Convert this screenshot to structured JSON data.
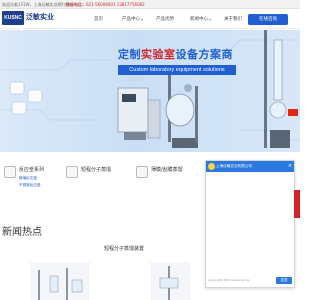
{
  "topbar": {
    "welcome": "欢迎光临131W，上海泛敏实业期刊模板中心…",
    "hotline": "热线电话：021-56008001 13817756062"
  },
  "header": {
    "logo_mark": "KUSNC",
    "logo_name": "泛敏实业",
    "nav": {
      "home": "首页",
      "products": "产品中心",
      "advantage": "产品优势",
      "news": "新闻中心",
      "about": "关于我们"
    },
    "consult_label": "在线咨询"
  },
  "banner": {
    "title_prefix": "定制",
    "title_highlight": "实验室",
    "title_suffix": "设备方案商",
    "subtitle": "Custom laboratory equipment solutions"
  },
  "categories": [
    {
      "label": "反应釜系列",
      "lines": [
        "玻璃反应釜",
        "不锈钢反应釜"
      ]
    },
    {
      "label": "短程分子蒸馏",
      "lines": []
    },
    {
      "label": "薄膜/刮膜蒸馏",
      "lines": []
    }
  ],
  "chat": {
    "title": "上海泛敏实业有限公司",
    "send_label": "发送",
    "footer": "Copyright 2024 powered by"
  },
  "news": {
    "title": "新闻热点",
    "headline_1": "短程分子蒸馏装置",
    "headline_2": "",
    "date": ""
  },
  "colors": {
    "brand_blue": "#1f5fd0",
    "accent_red": "#d3242b",
    "chat_blue": "#2a7ae2"
  }
}
